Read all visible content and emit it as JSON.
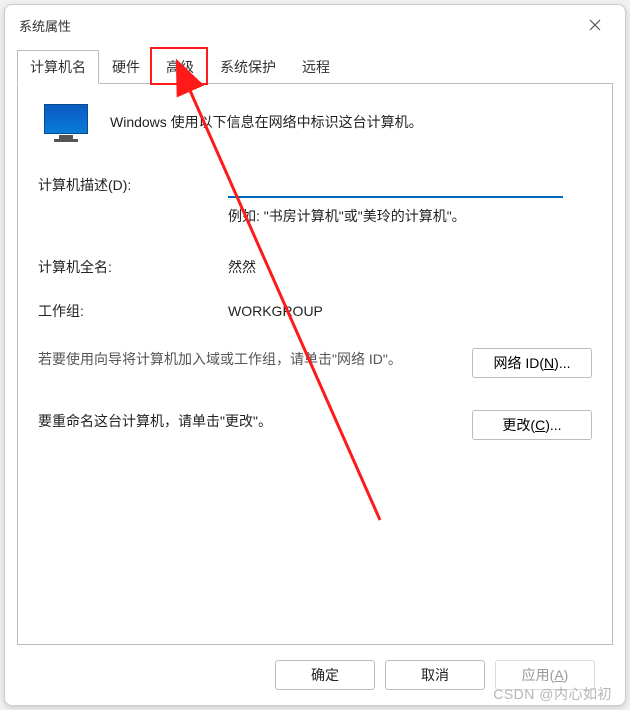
{
  "window": {
    "title": "系统属性"
  },
  "tabs": {
    "computer_name": "计算机名",
    "hardware": "硬件",
    "advanced": "高级",
    "system_protection": "系统保护",
    "remote": "远程"
  },
  "info_text": "Windows 使用以下信息在网络中标识这台计算机。",
  "form": {
    "description_label": "计算机描述(D):",
    "description_value": "",
    "example_text": "例如: \"书房计算机\"或\"美玲的计算机\"。",
    "fullname_label": "计算机全名:",
    "fullname_value": "然然",
    "workgroup_label": "工作组:",
    "workgroup_value": "WORKGROUP"
  },
  "actions": {
    "network_id_text": "若要使用向导将计算机加入域或工作组，请单击\"网络 ID\"。",
    "network_id_btn_prefix": "网络 ID(",
    "network_id_btn_ul": "N",
    "network_id_btn_suffix": ")...",
    "change_text": "要重命名这台计算机，请单击\"更改\"。",
    "change_btn_prefix": "更改(",
    "change_btn_ul": "C",
    "change_btn_suffix": ")..."
  },
  "footer": {
    "ok": "确定",
    "cancel": "取消",
    "apply_prefix": "应用(",
    "apply_ul": "A",
    "apply_suffix": ")"
  },
  "watermark": "CSDN @内心如初",
  "annotation": {
    "highlight_tab": "高级"
  }
}
